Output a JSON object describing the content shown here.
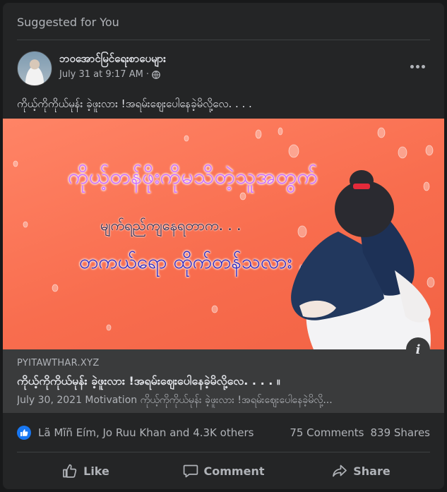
{
  "section_title": "Suggested for You",
  "post": {
    "author": "ဘဝအောင်မြင်ရေးစာပေများ",
    "date": "July 31 at 9:17 AM",
    "separator": "·",
    "privacy_icon": "globe-icon",
    "more_icon": "more-options-icon",
    "text": "ကိုယ့်ကိုကိုယ်မုန်း ခဲ့ဖူးလား !အရမ်းဈေးပေါနေခဲ့မိလို့လေ. . . ."
  },
  "image": {
    "line1": "ကိုယ့်တန်ဖိုးကိုမသိတဲ့သူအတွက်",
    "line2": "မျက်ရည်ကျနေရတာက. . .",
    "line3": "တကယ်ရော ထိုက်တန်သလား ,",
    "info_label": "i",
    "colors": {
      "background": "#f86d4e",
      "line1": "#cc6dff",
      "line3": "#2f2ac0"
    }
  },
  "link_preview": {
    "domain": "PYITAWTHAR.XYZ",
    "title": "ကိုယ့်ကိုကိုယ်မုန်း ခဲ့ဖူးလား !အရမ်းဈေးပေါနေခဲ့မိလို့လေ. . . . ။",
    "description": "July 30, 2021 Motivation ကိုယ့်ကိုကိုယ်မုန်း ခဲ့ဖူးလား !အရမ်းဈေးပေါနေခဲ့မိလို့..."
  },
  "reactions": {
    "icon": "like-reaction-icon",
    "names": "Lã Mĩñ Eím, Jo Ruu Khan and 4.3K others",
    "comments": "75 Comments",
    "shares": "839 Shares"
  },
  "actions": [
    {
      "label": "Like",
      "icon": "thumbs-up-icon"
    },
    {
      "label": "Comment",
      "icon": "comment-icon"
    },
    {
      "label": "Share",
      "icon": "share-icon"
    }
  ],
  "colors": {
    "page_bg": "#18191a",
    "card_bg": "#242526",
    "link_bg": "#3a3b3c",
    "primary_text": "#e4e6eb",
    "secondary_text": "#b0b3b8",
    "accent": "#1877f2"
  }
}
